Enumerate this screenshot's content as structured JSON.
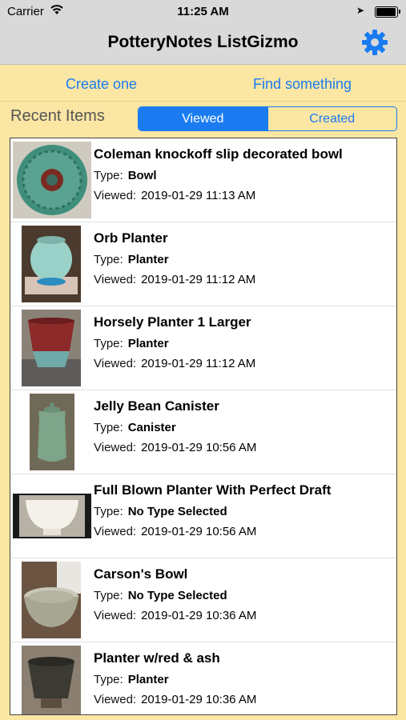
{
  "status_bar": {
    "carrier": "Carrier",
    "time": "11:25 AM"
  },
  "nav": {
    "title": "PotteryNotes ListGizmo",
    "settings_icon": "gear-icon"
  },
  "actions": {
    "create": "Create one",
    "find": "Find something"
  },
  "recent": {
    "label": "Recent Items",
    "segments": [
      "Viewed",
      "Created"
    ],
    "selected": "Viewed"
  },
  "labels": {
    "type": "Type:",
    "viewed": "Viewed:"
  },
  "items": [
    {
      "name": "Coleman knockoff slip decorated bowl",
      "type": "Bowl",
      "viewed": "2019-01-29 11:13 AM"
    },
    {
      "name": "Orb Planter",
      "type": "Planter",
      "viewed": "2019-01-29 11:12 AM"
    },
    {
      "name": "Horsely Planter 1 Larger",
      "type": "Planter",
      "viewed": "2019-01-29 11:12 AM"
    },
    {
      "name": "Jelly Bean Canister",
      "type": "Canister",
      "viewed": "2019-01-29 10:56 AM"
    },
    {
      "name": "Full Blown Planter With Perfect Draft",
      "type": "No Type Selected",
      "viewed": "2019-01-29 10:56 AM"
    },
    {
      "name": "Carson's Bowl",
      "type": "No Type Selected",
      "viewed": "2019-01-29 10:36 AM"
    },
    {
      "name": "Planter w/red & ash",
      "type": "Planter",
      "viewed": "2019-01-29 10:36 AM"
    }
  ],
  "colors": {
    "accent": "#1a7cf0",
    "background": "#fbe6a4",
    "bar": "#d9d9d9"
  }
}
